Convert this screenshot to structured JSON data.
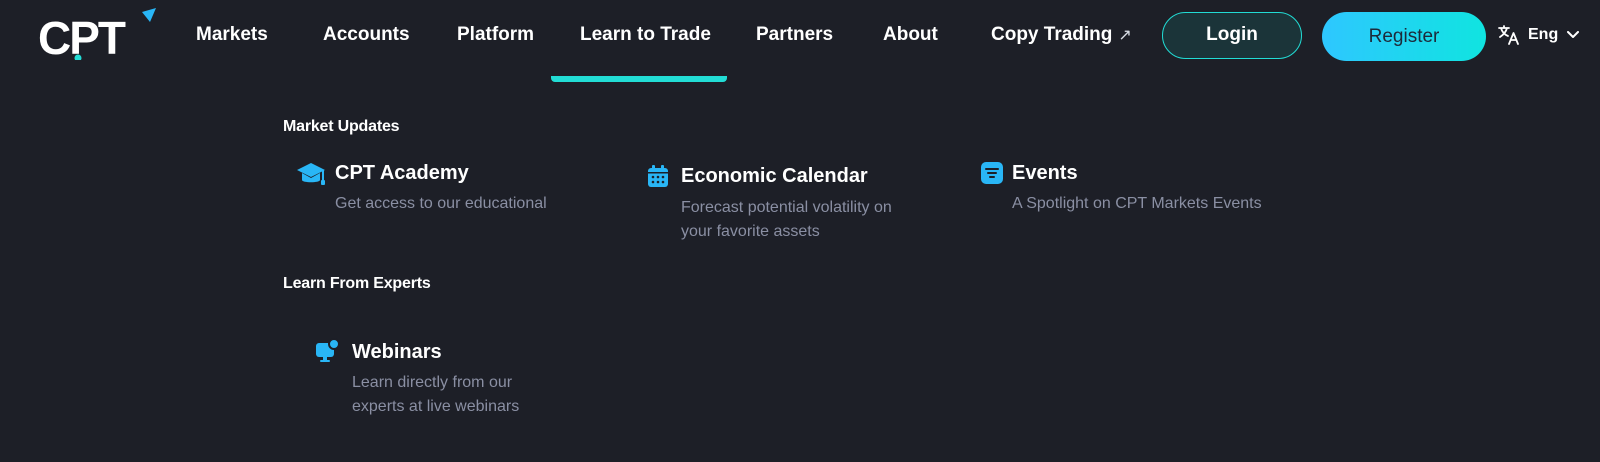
{
  "brand": {
    "logo_text": "CPT",
    "accent": "#22dcd5",
    "icon_blue": "#29b6f6"
  },
  "nav": {
    "items": [
      {
        "label": "Markets"
      },
      {
        "label": "Accounts"
      },
      {
        "label": "Platform"
      },
      {
        "label": "Learn to Trade",
        "active": true
      },
      {
        "label": "Partners"
      },
      {
        "label": "About"
      },
      {
        "label": "Copy Trading",
        "external_icon": "arrow-up-right-icon",
        "external_glyph": "↗"
      }
    ],
    "login_label": "Login",
    "register_label": "Register",
    "language": {
      "label": "Eng",
      "icon": "translate-icon",
      "caret": "chevron-down-icon"
    }
  },
  "menu": {
    "sections": [
      {
        "title": "Market Updates",
        "items": [
          {
            "title": "CPT Academy",
            "description": "Get access to our educational",
            "icon": "graduation-cap-icon"
          },
          {
            "title": "Economic Calendar",
            "description_lines": [
              "Forecast potential volatility on",
              "your favorite assets"
            ],
            "icon": "calendar-icon"
          },
          {
            "title": "Events",
            "description": "A Spotlight on CPT Markets Events",
            "icon": "events-list-icon"
          }
        ]
      },
      {
        "title": "Learn From Experts",
        "items": [
          {
            "title": "Webinars",
            "description_lines": [
              "Learn directly from our",
              "experts at live webinars"
            ],
            "icon": "webinar-icon"
          }
        ]
      }
    ]
  }
}
